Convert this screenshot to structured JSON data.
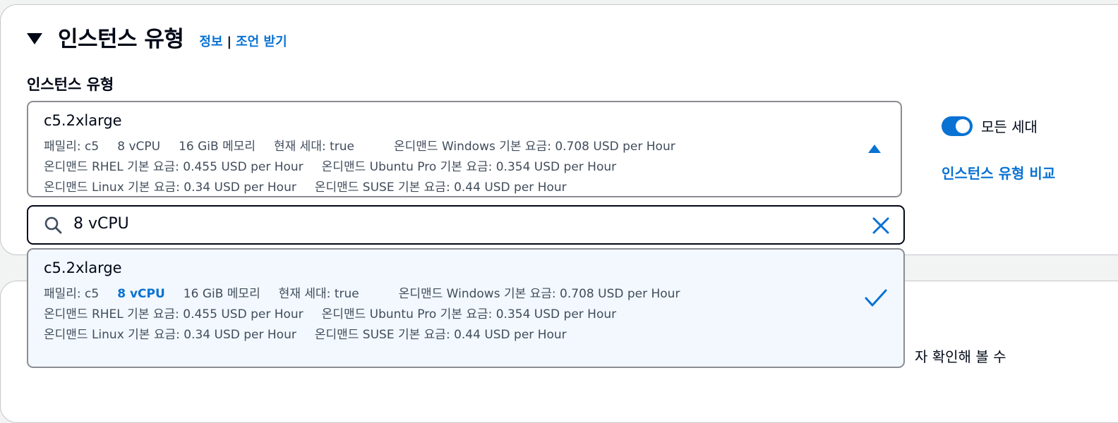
{
  "section": {
    "title": "인스턴스 유형",
    "info_link": "정보",
    "separator": "|",
    "advice_link": "조언 받기"
  },
  "field_label": "인스턴스 유형",
  "selected": {
    "name": "c5.2xlarge",
    "line1": [
      "패밀리: c5",
      "8 vCPU",
      "16 GiB 메모리",
      "현재 세대: true",
      "온디맨드 Windows 기본 요금: 0.708 USD per Hour"
    ],
    "line2": [
      "온디맨드 RHEL 기본 요금: 0.455 USD per Hour",
      "온디맨드 Ubuntu Pro 기본 요금: 0.354 USD per Hour"
    ],
    "line3": [
      "온디맨드 Linux 기본 요금: 0.34 USD per Hour",
      "온디맨드 SUSE 기본 요금: 0.44 USD per Hour"
    ]
  },
  "toggle": {
    "label": "모든 세대",
    "on": true
  },
  "compare_link": "인스턴스 유형 비교",
  "search": {
    "value": "8 vCPU"
  },
  "option": {
    "name": "c5.2xlarge",
    "line1": [
      "패밀리: c5",
      "8 vCPU",
      "16 GiB 메모리",
      "현재 세대: true",
      "온디맨드 Windows 기본 요금: 0.708 USD per Hour"
    ],
    "line2": [
      "온디맨드 RHEL 기본 요금: 0.455 USD per Hour",
      "온디맨드 Ubuntu Pro 기본 요금: 0.354 USD per Hour"
    ],
    "line3": [
      "온디맨드 Linux 기본 요금: 0.34 USD per Hour",
      "온디맨드 SUSE 기본 요금: 0.44 USD per Hour"
    ],
    "selected": true
  },
  "behind_text": "자 확인해 볼 수",
  "colors": {
    "accent": "#0972d3",
    "option_bg": "#f2f8fd"
  }
}
